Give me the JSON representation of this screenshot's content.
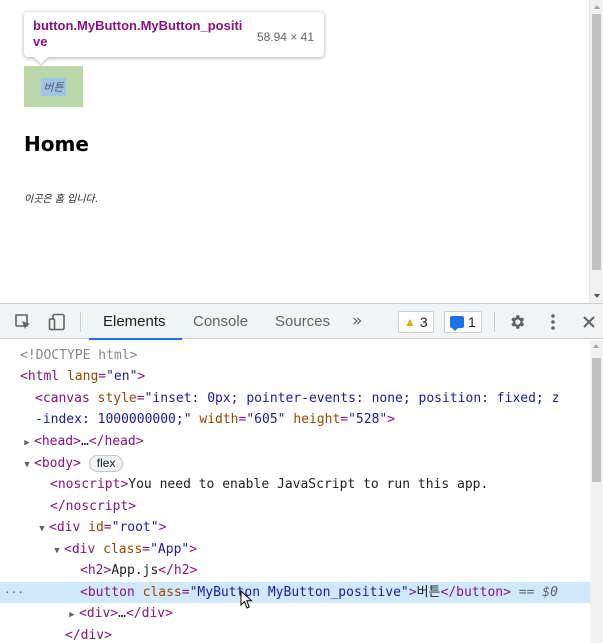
{
  "viewport": {
    "tooltip": {
      "selector": "button.MyButton.MyButton_positive",
      "size": "58.94 × 41"
    },
    "button_label": "버튼",
    "heading": "Home",
    "paragraph": "이곳은 홈 입니다."
  },
  "devtools": {
    "tabs": [
      "Elements",
      "Console",
      "Sources"
    ],
    "more_tabs_label": "»",
    "warnings_count": "3",
    "messages_count": "1",
    "icons": {
      "inspect": "inspect-element-icon",
      "device": "device-toolbar-icon",
      "warning": "warning-icon",
      "message": "message-icon",
      "settings": "gear-icon",
      "menu": "kebab-menu-icon",
      "close": "close-icon"
    },
    "dom": {
      "doctype": "<!DOCTYPE html>",
      "html_open_tag": "<html",
      "html_lang_attr": "lang",
      "html_lang_val": "\"en\"",
      "canvas_line1": {
        "tag": "<canvas",
        "attr": "style",
        "val": "\"inset: 0px; pointer-events: none; position: fixed; z"
      },
      "canvas_line2": {
        "val": "-index: 1000000000;\"",
        "width_attr": "width",
        "width_val": "\"605\"",
        "height_attr": "height",
        "height_val": "\"528\"",
        "close": ">"
      },
      "head": {
        "open": "<head>",
        "ellipsis": "…",
        "close": "</head>"
      },
      "body": {
        "open": "<body>",
        "badge": "flex"
      },
      "noscript": {
        "open": "<noscript>",
        "text": "You need to enable JavaScript to run this app.",
        "close": "</noscript>"
      },
      "root_div": {
        "tag": "<div",
        "attr": "id",
        "val": "\"root\"",
        "close": ">"
      },
      "app_div": {
        "tag": "<div",
        "attr": "class",
        "val": "\"App\"",
        "close": ">"
      },
      "h2": {
        "open": "<h2>",
        "text": "App.js",
        "close": "</h2>"
      },
      "button": {
        "tag": "<button",
        "attr": "class",
        "val": "\"MyButton MyButton_positive\"",
        "gt": ">",
        "text": "버튼",
        "close": "</button>",
        "eq": "== $0"
      },
      "collapsed_div": {
        "open": "<div>",
        "ellipsis": "…",
        "close": "</div>"
      },
      "div_close": "</div>"
    }
  },
  "colors": {
    "highlight_margin": "#b9d8a9",
    "highlight_content": "#9fc4e8",
    "selected_row": "#cfe8fc",
    "tag": "#881280",
    "attr_name": "#994500",
    "attr_value": "#1a1aa6",
    "active_tab_underline": "#1a73e8"
  }
}
